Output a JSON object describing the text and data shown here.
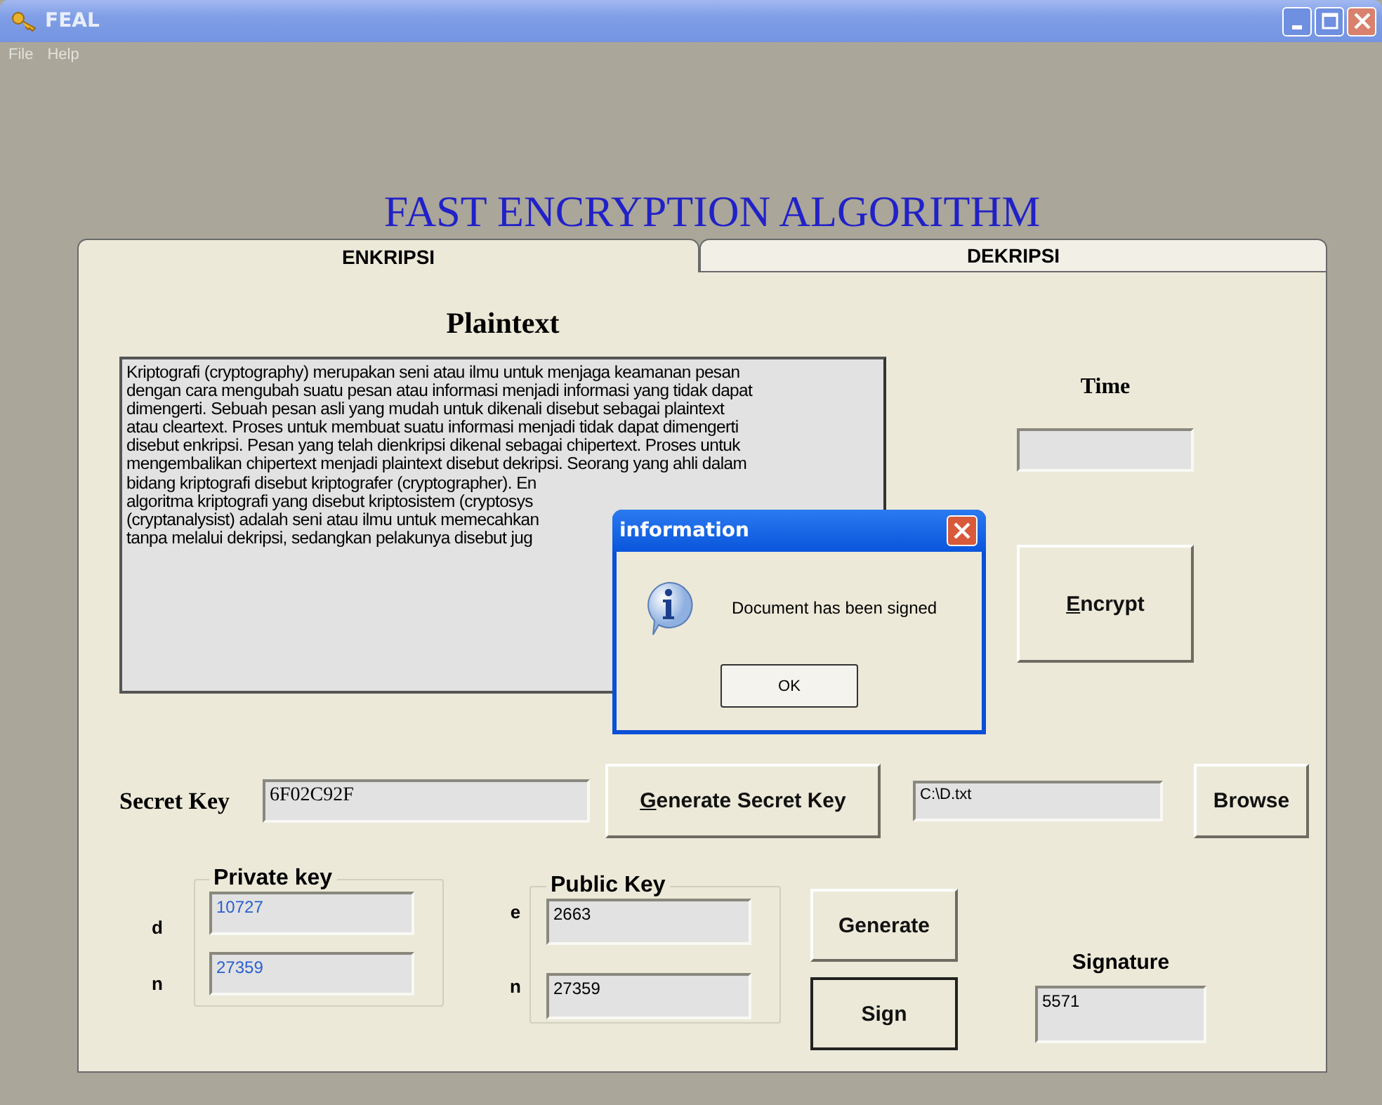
{
  "window": {
    "title": "FEAL"
  },
  "menu": [
    "File",
    "Help"
  ],
  "heading": "FAST ENCRYPTION ALGORITHM",
  "tabs": [
    {
      "label": "ENKRIPSI",
      "selected": true
    },
    {
      "label": "DEKRIPSI",
      "selected": false
    }
  ],
  "plaintext": {
    "label": "Plaintext",
    "lines": [
      "Kriptografi (cryptography) merupakan seni atau ilmu untuk menjaga keamanan pesan",
      "dengan cara mengubah suatu pesan atau informasi menjadi informasi yang tidak dapat",
      "dimengerti. Sebuah pesan asli yang mudah untuk dikenali disebut sebagai plaintext",
      "atau cleartext. Proses untuk membuat suatu informasi menjadi tidak dapat dimengerti",
      "disebut enkripsi. Pesan yang telah dienkripsi dikenal sebagai chipertext. Proses untuk",
      "mengembalikan chipertext menjadi plaintext disebut dekripsi. Seorang yang ahli dalam",
      "bidang kriptografi disebut kriptografer (cryptographer). En",
      "algoritma kriptografi yang disebut kriptosistem (cryptosys",
      "(cryptanalysist) adalah seni atau ilmu untuk memecahkan",
      "tanpa melalui dekripsi, sedangkan pelakunya disebut jug"
    ]
  },
  "time": {
    "label": "Time"
  },
  "encrypt_button": {
    "mnemonic": "E",
    "rest": "ncrypt"
  },
  "secret_key": {
    "label": "Secret Key",
    "value": "6F02C92F"
  },
  "generate_secret_key_button": {
    "mnemonic": "G",
    "rest": "enerate Secret Key"
  },
  "file_path": {
    "value": "C:\\D.txt"
  },
  "browse_button": "Browse",
  "private_key": {
    "title": "Private key",
    "fields": [
      {
        "label": "d",
        "value": "10727"
      },
      {
        "label": "n",
        "value": "27359"
      }
    ]
  },
  "public_key": {
    "title": "Public Key",
    "fields": [
      {
        "label": "e",
        "value": "2663"
      },
      {
        "label": "n",
        "value": "27359"
      }
    ]
  },
  "action_buttons": [
    {
      "label": "Generate",
      "focused": false
    },
    {
      "label": "Sign",
      "focused": true
    }
  ],
  "signature": {
    "label": "Signature",
    "value": "5571"
  },
  "dialog": {
    "title": "information",
    "message": "Document has been signed",
    "button": "OK"
  }
}
